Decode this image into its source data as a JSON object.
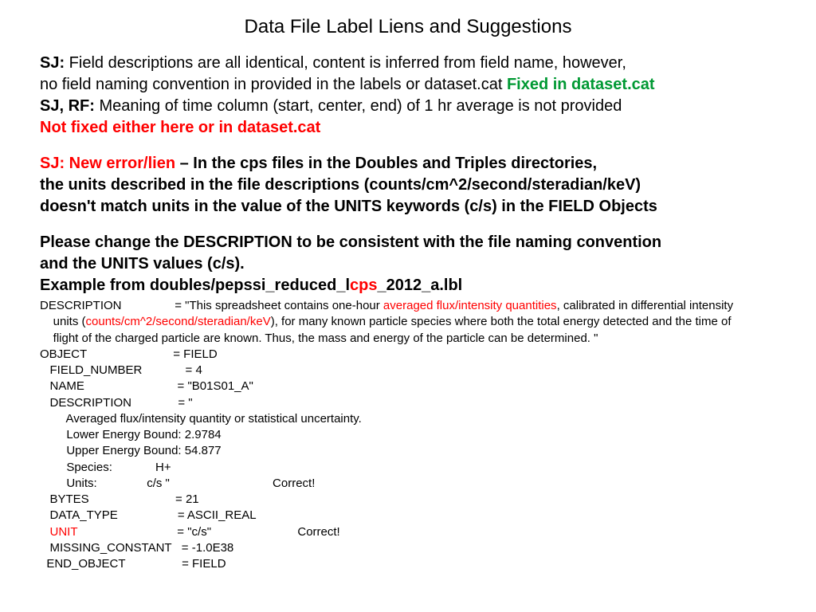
{
  "title": "Data File Label Liens and Suggestions",
  "p1": {
    "sj_label": "SJ:",
    "line1": " Field descriptions are all identical, content is inferred from field name, however,",
    "line2": "no field naming convention in provided in the labels or dataset.cat ",
    "fixed": "Fixed in dataset.cat",
    "sjrf_label": "SJ, RF:",
    "line3": " Meaning of time column (start, center, end) of 1 hr average is not provided",
    "notfixed": "Not fixed either here or in dataset.cat"
  },
  "p2": {
    "lead": "SJ: New error/lien",
    "rest1": " – In the cps files in the Doubles and Triples directories,",
    "line2": "the units described in the file descriptions (counts/cm^2/second/steradian/keV)",
    "line3": "doesn't match units in the value of the UNITS keywords (c/s) in the FIELD Objects"
  },
  "p3": {
    "line1": "Please change the DESCRIPTION to be consistent with the file naming convention",
    "line2": "and the UNITS values (c/s).",
    "ex_pre": "Example from doubles/pepssi_reduced_l",
    "ex_red": "cps",
    "ex_post": "_2012_a.lbl"
  },
  "code": {
    "l1a": "DESCRIPTION                = \"This spreadsheet contains one-hour ",
    "l1r": "averaged flux/intensity quantities",
    "l1b": ", calibrated in differential intensity",
    "l2a": "    units (",
    "l2r": "counts/cm^2/second/steradian/keV",
    "l2b": "), for many known particle species where both the total energy detected and the time of",
    "l3": "    flight of the charged particle are known. Thus, the mass and energy of the particle can be determined. \"",
    "l4": "OBJECT                          = FIELD",
    "l5": "   FIELD_NUMBER             = 4",
    "l6": "   NAME                            = \"B01S01_A\"",
    "l7": "   DESCRIPTION              = \"",
    "l8": "        Averaged flux/intensity quantity or statistical uncertainty.",
    "l9": "        Lower Energy Bound: 2.9784",
    "l10": "        Upper Energy Bound: 54.877",
    "l11": "        Species:             H+",
    "l12": "        Units:               c/s \"                               Correct!",
    "l13": "   BYTES                          = 21",
    "l14": "   DATA_TYPE                  = ASCII_REAL",
    "l15a": "   ",
    "l15r": "UNIT",
    "l15b": "                              = \"c/s\"                          Correct!",
    "l16": "   MISSING_CONSTANT   = -1.0E38",
    "l17": "  END_OBJECT                 = FIELD"
  }
}
